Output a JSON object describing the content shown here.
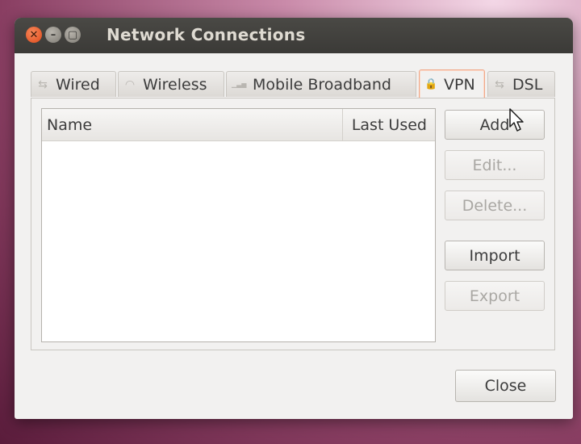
{
  "window": {
    "title": "Network Connections"
  },
  "titlebar_buttons": {
    "close_glyph": "✕",
    "min_glyph": "–",
    "max_glyph": "▢"
  },
  "tabs": [
    {
      "label": "Wired",
      "icon": "wired-icon",
      "glyph": "⇆",
      "active": false
    },
    {
      "label": "Wireless",
      "icon": "wireless-icon",
      "glyph": "◠",
      "active": false
    },
    {
      "label": "Mobile Broadband",
      "icon": "signal-bars-icon",
      "glyph": "▁▃▅",
      "active": false
    },
    {
      "label": "VPN",
      "icon": "lock-icon",
      "glyph": "🔒",
      "active": true
    },
    {
      "label": "DSL",
      "icon": "dsl-icon",
      "glyph": "⇆",
      "active": false
    }
  ],
  "list": {
    "columns": {
      "name": "Name",
      "last_used": "Last Used"
    },
    "rows": []
  },
  "actions": {
    "add": "Add",
    "edit": "Edit...",
    "delete": "Delete...",
    "import": "Import",
    "export": "Export"
  },
  "footer": {
    "close": "Close"
  }
}
